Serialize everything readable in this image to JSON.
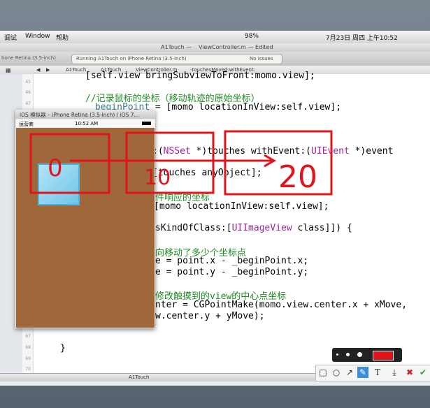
{
  "menubar": {
    "items": [
      "调试",
      "Window",
      "帮助"
    ],
    "battery": "98%",
    "datetime": "7月23日 周四 上午10:52"
  },
  "xcode": {
    "window_title": "A1Touch — ",
    "document_title": "ViewController.m — Edited",
    "scheme_left": "hone Retina (3.5-inch)",
    "status_running": "Running A1Touch on iPhone Retina (3.5-inch)",
    "status_issues": "No Issues",
    "jumpbar": [
      "A1Touch",
      "A1Touch",
      "ViewController.m",
      "-touchesMoved:withEvent:"
    ],
    "bottom_target": "A1Touch",
    "line_numbers": [
      "45",
      "46",
      "47",
      "48",
      "",
      "",
      "",
      "",
      "",
      "",
      "",
      "",
      "",
      "",
      "",
      "",
      "",
      "",
      "",
      "",
      "",
      "",
      "67",
      "68",
      "69",
      "70"
    ]
  },
  "code": {
    "line1": "[self.view bringSubviewToFront:momo.view];",
    "line2": "//记录鼠标的坐标（移动轨迹的原始坐标）",
    "line3_a": "_beginPoint",
    "line3_b": " = [momo locationInView:self.view];",
    "line4_a": ":(",
    "line4_kw": "NSSet",
    "line4_b": " *)touches withEvent:(",
    "line4_kw2": "UIEvent",
    "line4_c": " *)event",
    "line5": "[touches anyObject];",
    "line6": "件响应的坐标",
    "line7": "[momo locationInView:self.view];",
    "line8_a": "sKindOfClass:[",
    "line8_b": "UIImageView",
    "line8_c": " class]]) {",
    "line9": "向移动了多少个坐标点",
    "line10": "e = point.x - _beginPoint.x;",
    "line11": "e = point.y - _beginPoint.y;",
    "line12": "修改触摸到的view的中心点坐标",
    "line13": "nter = CGPointMake(momo.view.center.x + xMove,",
    "line14": "w.center.y + yMove);",
    "line15": "}"
  },
  "simulator": {
    "title": "iOS 模拟器 – iPhone Retina (3.5-inch) / iOS 7...",
    "carrier": "运营商",
    "time": "10:52 AM"
  },
  "annotations": {
    "labels": [
      "0",
      "10",
      "20"
    ],
    "color": "#e0141c"
  },
  "annot_tools": {
    "tools": [
      "rectangle-tool",
      "ellipse-tool",
      "arrow-tool",
      "pen-tool",
      "text-tool",
      "save-tool",
      "cancel-tool",
      "confirm-tool"
    ],
    "text_tool_label": "T",
    "cancel_label": "✖",
    "confirm_label": "✔"
  }
}
